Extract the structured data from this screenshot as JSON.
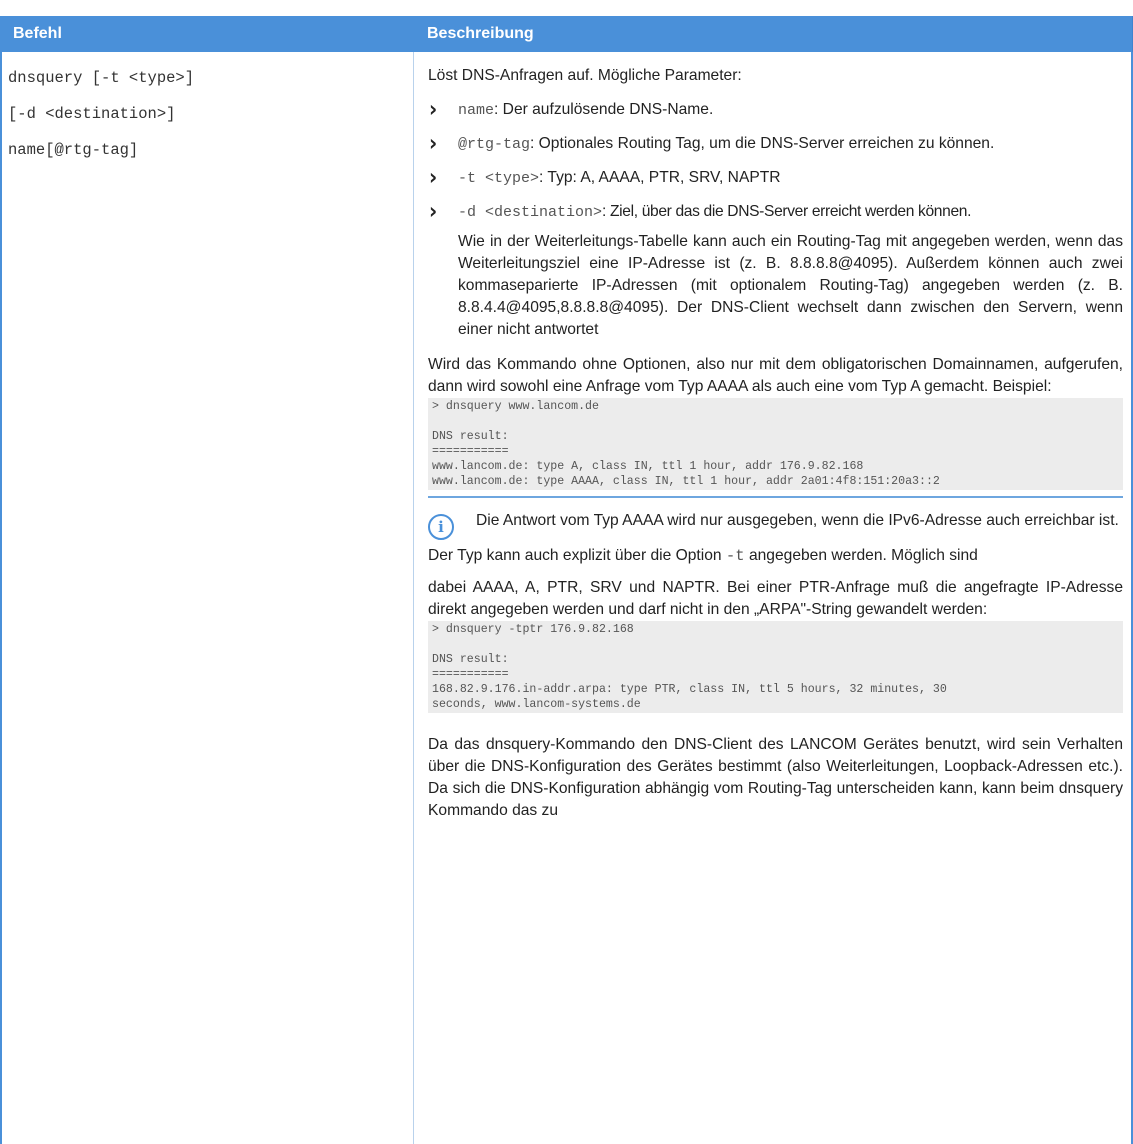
{
  "table": {
    "header": {
      "col1": "Befehl",
      "col2": "Beschreibung"
    },
    "command_lines": [
      "dnsquery [-t <type>]",
      "[-d <destination>]",
      "name[@rtg-tag]"
    ],
    "intro": "Löst DNS-Anfragen auf. Mögliche Parameter:",
    "options": [
      {
        "code": "name",
        "text": ": Der aufzulösende DNS-Name."
      },
      {
        "code": "@rtg-tag",
        "text": ": Optionales Routing Tag, um die DNS-Server erreichen zu können."
      },
      {
        "code": "-t <type>",
        "text": ": Typ: A, AAAA, PTR, SRV, NAPTR"
      },
      {
        "code": "-d <destination>",
        "text": ": Ziel, über das die DNS-Server erreicht werden können."
      }
    ],
    "destination_note": "Wie in der Weiterleitungs-Tabelle kann auch ein Routing-Tag mit angegeben werden, wenn das Weiterleitungsziel eine IP-Adresse ist (z. B. 8.8.8.8@4095). Außerdem können auch zwei kommaseparierte IP-Adressen (mit optionalem Routing-Tag) angegeben werden (z. B. 8.8.4.4@4095,8.8.8.8@4095). Der DNS-Client wechselt dann zwischen den Servern, wenn einer nicht antwortet",
    "para_default": "Wird das Kommando ohne Optionen, also nur mit dem obligatorischen Domainnamen, aufgerufen, dann wird sowohl eine Anfrage vom Typ AAAA als auch eine vom Typ A gemacht. Beispiel:",
    "example1": "> dnsquery www.lancom.de\n\nDNS result:\n===========\nwww.lancom.de: type A, class IN, ttl 1 hour, addr 176.9.82.168\nwww.lancom.de: type AAAA, class IN, ttl 1 hour, addr 2a01:4f8:151:20a3::2",
    "note": "Die Antwort vom Typ AAAA wird nur ausgegeben, wenn die IPv6-Adresse auch erreichbar ist.",
    "para_type_a": "Der Typ kann auch explizit über die Option ",
    "para_type_code": "-t",
    "para_type_b": " angegeben werden. Möglich sind",
    "para_ptr": "dabei AAAA, A, PTR, SRV und NAPTR. Bei einer PTR-Anfrage muß die angefragte IP-Adresse direkt angegeben werden und darf nicht in den „ARPA\"-String gewandelt werden:",
    "example2": "> dnsquery -tptr 176.9.82.168\n\nDNS result:\n===========\n168.82.9.176.in-addr.arpa: type PTR, class IN, ttl 5 hours, 32 minutes, 30\nseconds, www.lancom-systems.de",
    "para_final": "Da das dnsquery-Kommando den DNS-Client des LANCOM Gerätes benutzt, wird sein Verhalten über die DNS-Konfiguration des Gerätes bestimmt (also Weiterleitungen, Loopback-Adressen etc.). Da sich die DNS-Konfiguration abhängig vom Routing-Tag unterscheiden kann, kann beim dnsquery Kommando das zu"
  },
  "colors": {
    "header_bg": "#4a90d9",
    "code_bg": "#ececec",
    "rule": "#6ea6df"
  }
}
